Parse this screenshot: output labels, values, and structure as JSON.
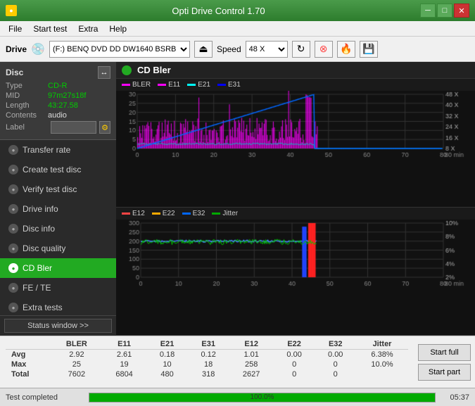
{
  "titlebar": {
    "title": "Opti Drive Control 1.70",
    "minimize": "─",
    "maximize": "□",
    "close": "✕"
  },
  "menu": {
    "items": [
      "File",
      "Start test",
      "Extra",
      "Help"
    ]
  },
  "toolbar": {
    "drive_label": "Drive",
    "drive_value": "(F:)  BENQ DVD DD DW1640 BSRB",
    "speed_label": "Speed",
    "speed_value": "48 X"
  },
  "disc": {
    "header": "Disc",
    "type_label": "Type",
    "type_value": "CD-R",
    "mid_label": "MID",
    "mid_value": "97m27s18f",
    "length_label": "Length",
    "length_value": "43:27.58",
    "contents_label": "Contents",
    "contents_value": "audio",
    "label_label": "Label",
    "label_value": ""
  },
  "nav": {
    "items": [
      {
        "id": "transfer-rate",
        "label": "Transfer rate",
        "active": false
      },
      {
        "id": "create-test-disc",
        "label": "Create test disc",
        "active": false
      },
      {
        "id": "verify-test-disc",
        "label": "Verify test disc",
        "active": false
      },
      {
        "id": "drive-info",
        "label": "Drive info",
        "active": false
      },
      {
        "id": "disc-info",
        "label": "Disc info",
        "active": false
      },
      {
        "id": "disc-quality",
        "label": "Disc quality",
        "active": false
      },
      {
        "id": "cd-bler",
        "label": "CD Bler",
        "active": true
      },
      {
        "id": "fe-te",
        "label": "FE / TE",
        "active": false
      },
      {
        "id": "extra-tests",
        "label": "Extra tests",
        "active": false
      }
    ]
  },
  "chart": {
    "title": "CD Bler",
    "top": {
      "legend": [
        {
          "label": "BLER",
          "color": "#ff00ff"
        },
        {
          "label": "E11",
          "color": "#ff00ff"
        },
        {
          "label": "E21",
          "color": "#00ffff"
        },
        {
          "label": "E31",
          "color": "#0000ff"
        }
      ],
      "y_max": 30,
      "y_right_max": "48 X",
      "y_right_labels": [
        "48 X",
        "40 X",
        "32 X",
        "24 X",
        "16 X",
        "8 X"
      ]
    },
    "bottom": {
      "legend": [
        {
          "label": "E12",
          "color": "#ff4444"
        },
        {
          "label": "E22",
          "color": "#ffaa00"
        },
        {
          "label": "E32",
          "color": "#00aaff"
        },
        {
          "label": "Jitter",
          "color": "#00ff00"
        }
      ],
      "y_max": 300,
      "y_right_max": "10%",
      "y_right_labels": [
        "10%",
        "8%",
        "6%",
        "4%",
        "2%"
      ]
    }
  },
  "stats": {
    "headers": [
      "",
      "BLER",
      "E11",
      "E21",
      "E31",
      "E12",
      "E22",
      "E32",
      "Jitter"
    ],
    "rows": [
      {
        "label": "Avg",
        "values": [
          "2.92",
          "2.61",
          "0.18",
          "0.12",
          "1.01",
          "0.00",
          "0.00",
          "6.38%"
        ]
      },
      {
        "label": "Max",
        "values": [
          "25",
          "19",
          "10",
          "18",
          "258",
          "0",
          "0",
          "10.0%"
        ]
      },
      {
        "label": "Total",
        "values": [
          "7602",
          "6804",
          "480",
          "318",
          "2627",
          "0",
          "0",
          ""
        ]
      }
    ],
    "buttons": [
      {
        "id": "start-full",
        "label": "Start full"
      },
      {
        "id": "start-part",
        "label": "Start part"
      }
    ]
  },
  "statusbar": {
    "status_window_label": "Status window >>",
    "test_status": "Test completed"
  },
  "bottombar": {
    "status": "Test completed",
    "progress": 100.0,
    "progress_text": "100.0%",
    "time": "05:37"
  }
}
